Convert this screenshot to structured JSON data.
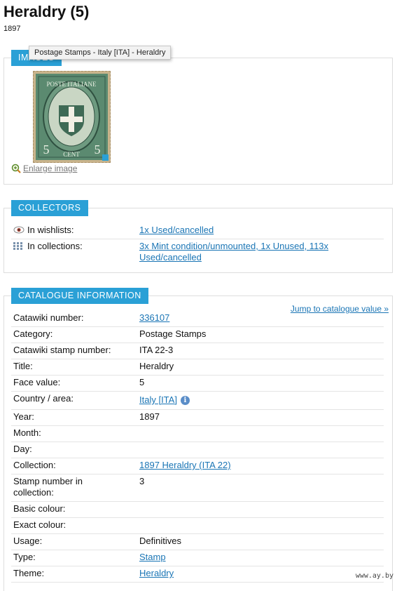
{
  "page": {
    "title": "Heraldry (5)",
    "year": "1897"
  },
  "tooltip": "Postage Stamps - Italy [ITA] - Heraldry",
  "images": {
    "header": "IMAGES",
    "stamp": {
      "top_text": "POSTE ITALIANE",
      "bottom_text": "CENT",
      "value": "5"
    },
    "enlarge_label": "Enlarge image"
  },
  "collectors": {
    "header": "COLLECTORS",
    "wishlists_label": "In wishlists:",
    "wishlists_value": "1x Used/cancelled",
    "collections_label": "In collections:",
    "collections_value": "3x Mint condition/unmounted, 1x Unused, 113x Used/cancelled"
  },
  "catalogue": {
    "header": "CATALOGUE INFORMATION",
    "jump_link": "Jump to catalogue value »",
    "rows": [
      {
        "label": "Catawiki number:",
        "value": "336107"
      },
      {
        "label": "Category:",
        "value": "Postage Stamps"
      },
      {
        "label": "Catawiki stamp number:",
        "value": "ITA 22-3"
      },
      {
        "label": "Title:",
        "value": "Heraldry"
      },
      {
        "label": "Face value:",
        "value": "5"
      },
      {
        "label": "Country / area:",
        "value": "Italy [ITA]"
      },
      {
        "label": "Year:",
        "value": "1897"
      },
      {
        "label": "Month:",
        "value": ""
      },
      {
        "label": "Day:",
        "value": ""
      },
      {
        "label": "Collection:",
        "value": "1897 Heraldry (ITA 22)"
      },
      {
        "label": "Stamp number in collection:",
        "value": "3"
      },
      {
        "label": "Basic colour:",
        "value": ""
      },
      {
        "label": "Exact colour:",
        "value": ""
      },
      {
        "label": "Usage:",
        "value": "Definitives"
      },
      {
        "label": "Type:",
        "value": "Stamp"
      },
      {
        "label": "Theme:",
        "value": "Heraldry"
      }
    ]
  },
  "watermark": "www.ay.by",
  "colors": {
    "accent": "#2aa0d6",
    "link": "#1a75b5",
    "stamp_green": "#4f7a62"
  },
  "icons": {
    "wishlist": "eye-icon",
    "collections": "grid-icon",
    "info": "info-icon",
    "enlarge": "magnifier-plus-icon"
  }
}
